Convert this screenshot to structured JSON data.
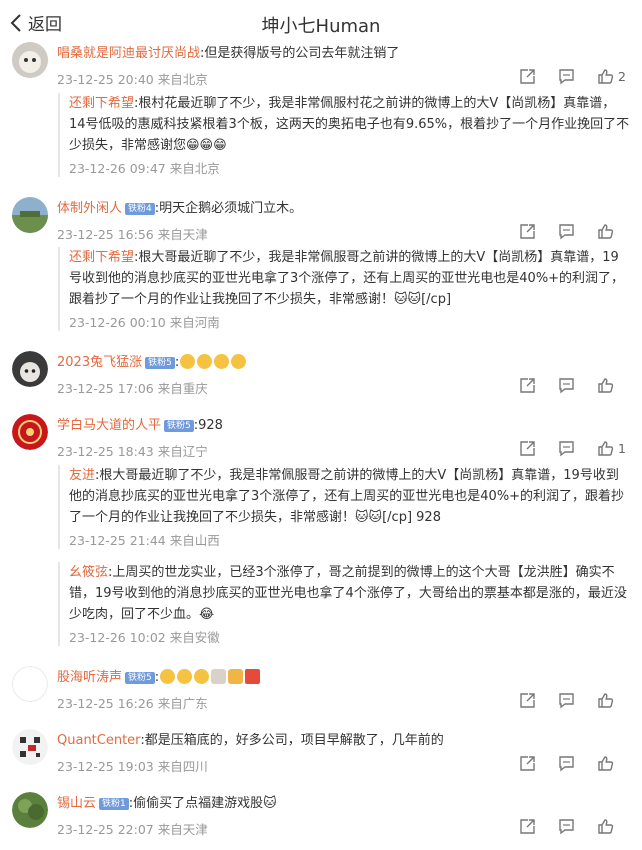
{
  "header": {
    "back_label": "返回",
    "title": "坤小七Human"
  },
  "comments": [
    {
      "user": "唱桑就是阿迪最讨厌尚战",
      "badge": "",
      "text": ":但是获得版号的公司去年就注销了",
      "meta": "23-12-25 20:40 来自北京",
      "likes": "2",
      "replies": [
        {
          "user": "还剩下希望",
          "text": ":根村花最近聊了不少，我是非常佩服村花之前讲的微博上的大V【尚凯杨】真靠谱，14号低吸的惠威科技紧根着3个板，这两天的奥拓电子也有9.65%，根着抄了一个月作业挽回了不少损失，非常感谢您😁😁😁",
          "meta": "23-12-26 09:47 来自北京"
        }
      ]
    },
    {
      "user": "体制外闲人",
      "badge": "铁粉4",
      "text": ":明天企鹅必须城门立木。",
      "meta": "23-12-25 16:56 来自天津",
      "likes": "",
      "replies": [
        {
          "user": "还剩下希望",
          "text": ":根大哥最近聊了不少，我是非常佩服哥之前讲的微博上的大V【尚凯杨】真靠谱，19号收到他的消息抄底买的亚世光电拿了3个涨停了，还有上周买的亚世光电也是40%+的利润了，跟着抄了一个月的作业让我挽回了不少损失，非常感谢！🐱🐱[/cp]",
          "meta": "23-12-26 00:10 来自河南"
        }
      ]
    },
    {
      "user": "2023兔飞猛涨",
      "badge": "铁粉5",
      "text": ":",
      "meta": "23-12-25 17:06 来自重庆",
      "likes": "",
      "replies": []
    },
    {
      "user": "学白马大道的人平",
      "badge": "铁粉5",
      "text": ":928",
      "meta": "23-12-25 18:43 来自辽宁",
      "likes": "1",
      "replies": [
        {
          "user": "友进",
          "text": ":根大哥最近聊了不少，我是非常佩服哥之前讲的微博上的大V【尚凯杨】真靠谱，19号收到他的消息抄底买的亚世光电拿了3个涨停了，还有上周买的亚世光电也是40%+的利润了，跟着抄了一个月的作业让我挽回了不少损失，非常感谢！🐱🐱[/cp]  928",
          "meta": "23-12-25 21:44 来自山西"
        },
        {
          "user": "幺筱弦",
          "text": ":上周买的世龙实业，已经3个涨停了，哥之前提到的微博上的这个大哥【龙洪胜】确实不错，19号收到他的消息抄底买的亚世光电也拿了4个涨停了，大哥给出的票基本都是涨的，最近没少吃肉，回了不少血。😂",
          "meta": "23-12-26 10:02 来自安徽"
        }
      ]
    },
    {
      "user": "股海听涛声",
      "badge": "铁粉5",
      "text": ":",
      "meta": "23-12-25 16:26 来自广东",
      "likes": "",
      "replies": []
    },
    {
      "user": "QuantCenter",
      "badge": "",
      "text": ":都是压箱底的，好多公司，项目早解散了，几年前的",
      "meta": "23-12-25 19:03 来自四川",
      "likes": "",
      "replies": []
    },
    {
      "user": "锡山云",
      "badge": "铁粉1",
      "text": ":偷偷买了点福建游戏股🐱",
      "meta": "23-12-25 22:07 来自天津",
      "likes": "",
      "replies": []
    }
  ],
  "icons": [
    "back-chevron-icon",
    "share-icon",
    "comment-icon",
    "like-icon"
  ],
  "colors": {
    "username": "#e36a3f",
    "badge": "#6f9bdc",
    "meta": "#999999"
  }
}
